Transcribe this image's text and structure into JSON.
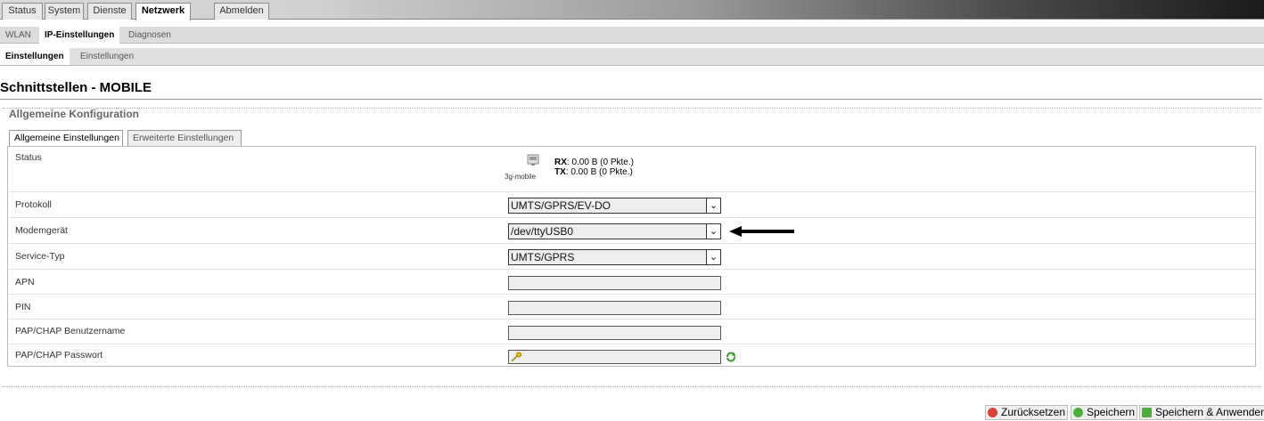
{
  "topnav": [
    "Status",
    "System",
    "Dienste",
    "Netzwerk",
    "Abmelden"
  ],
  "subnav": [
    "WLAN",
    "IP-Einstellungen",
    "Diagnosen"
  ],
  "subnav2": [
    "Einstellungen",
    "Einstellungen"
  ],
  "title": "Schnittstellen - MOBILE",
  "legend": "Allgemeine Konfiguration",
  "tabs": [
    "Allgemeine Einstellungen",
    "Erweiterte Einstellungen"
  ],
  "status": {
    "label": "Status",
    "device": "3g-mobile",
    "rx_label": "RX",
    "rx_value": ": 0.00 B (0 Pkte.)",
    "tx_label": "TX",
    "tx_value": ": 0.00 B (0 Pkte.)"
  },
  "fields": {
    "protokoll": {
      "label": "Protokoll",
      "value": "UMTS/GPRS/EV-DO"
    },
    "modem": {
      "label": "Modemgerät",
      "value": "/dev/ttyUSB0"
    },
    "service": {
      "label": "Service-Typ",
      "value": "UMTS/GPRS"
    },
    "apn": {
      "label": "APN",
      "value": ""
    },
    "pin": {
      "label": "PIN",
      "value": ""
    },
    "user": {
      "label": "PAP/CHAP Benutzername",
      "value": ""
    },
    "pass": {
      "label": "PAP/CHAP Passwort",
      "value": ""
    }
  },
  "buttons": {
    "reset": "Zurücksetzen",
    "save": "Speichern",
    "apply": "Speichern & Anwenden"
  },
  "icons": [
    "ethernet-port-icon",
    "key-icon",
    "refresh-icon",
    "reset-icon",
    "save-icon",
    "apply-icon",
    "arrow-left-icon",
    "chevron-down-icon"
  ]
}
